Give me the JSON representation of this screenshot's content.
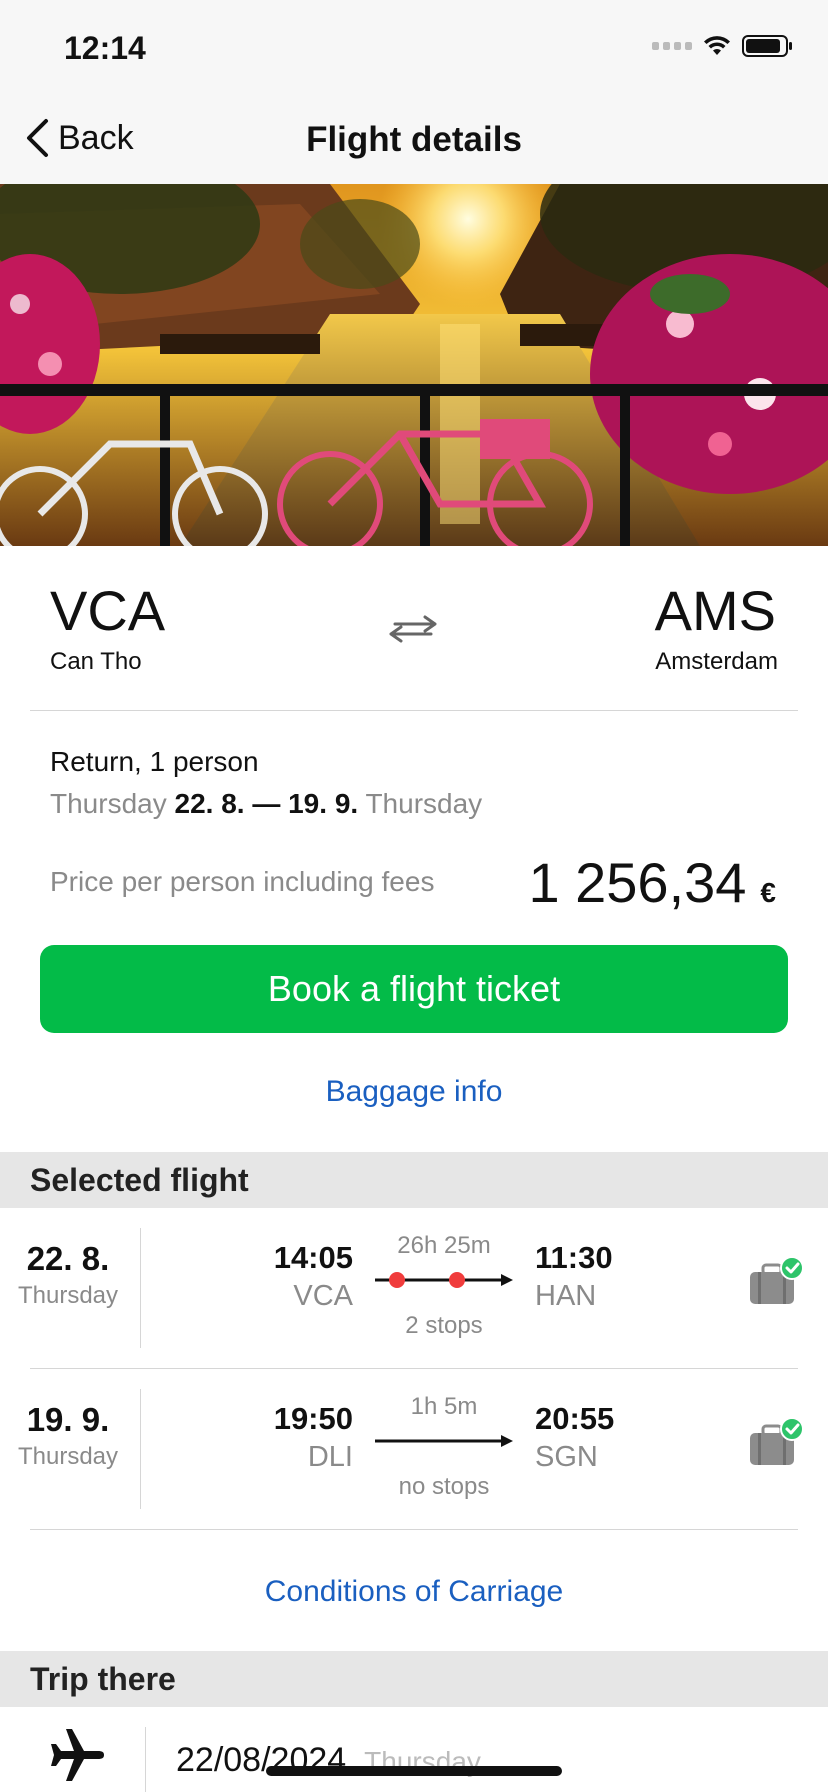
{
  "status": {
    "time": "12:14"
  },
  "nav": {
    "back_label": "Back",
    "title": "Flight details"
  },
  "route": {
    "from_code": "VCA",
    "from_city": "Can Tho",
    "to_code": "AMS",
    "to_city": "Amsterdam"
  },
  "trip": {
    "type": "Return, 1 person",
    "out_weekday": "Thursday",
    "date_range": "22. 8. — 19. 9.",
    "return_weekday": "Thursday"
  },
  "price": {
    "label": "Price per person including fees",
    "amount": "1 256,34",
    "currency": "€"
  },
  "actions": {
    "book_label": "Book a flight ticket",
    "baggage_label": "Baggage info",
    "conditions_label": "Conditions of Carriage"
  },
  "selected_flight": {
    "header": "Selected flight",
    "flights": [
      {
        "date": "22. 8.",
        "weekday": "Thursday",
        "dep_time": "14:05",
        "dep_code": "VCA",
        "duration": "26h 25m",
        "stops": "2 stops",
        "arr_time": "11:30",
        "arr_code": "HAN"
      },
      {
        "date": "19. 9.",
        "weekday": "Thursday",
        "dep_time": "19:50",
        "dep_code": "DLI",
        "duration": "1h 5m",
        "stops": "no stops",
        "arr_time": "20:55",
        "arr_code": "SGN"
      }
    ]
  },
  "trip_there": {
    "header": "Trip there",
    "date": "22/08/2024",
    "weekday": "Thursday"
  },
  "icons": {
    "back": "chevron-left-icon",
    "swap": "swap-arrows-icon",
    "baggage": "baggage-included-icon",
    "plane": "airplane-icon"
  },
  "colors": {
    "accent_green": "#03bb48",
    "link_blue": "#1a5fc0",
    "stop_red": "#f03c3c",
    "check_green": "#2ec46a"
  }
}
